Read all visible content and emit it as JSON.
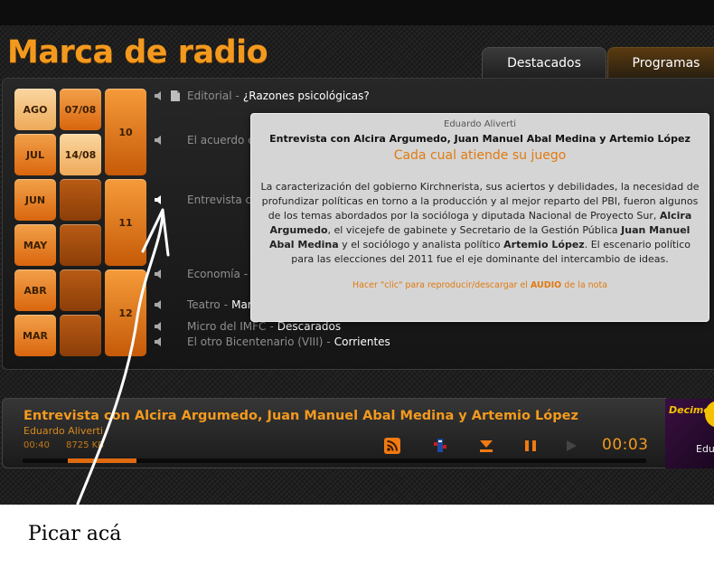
{
  "brand": "Marca de radio",
  "tabs": [
    {
      "label": "Destacados"
    },
    {
      "label": "Programas"
    }
  ],
  "calendar": {
    "months": [
      "AGO",
      "JUL",
      "JUN",
      "MAY",
      "ABR",
      "MAR"
    ],
    "dates": [
      "07/08",
      "14/08"
    ],
    "days": [
      "10",
      "11",
      "12"
    ]
  },
  "programs": [
    {
      "title": "Editorial",
      "item": "¿Razones psicológicas?"
    },
    {
      "title": "El acuerdo e",
      "item": ""
    },
    {
      "title": "Entrevista co",
      "item": ""
    },
    {
      "title": "Economía",
      "item": ""
    },
    {
      "title": "Teatro",
      "item": "Mariano Moreno"
    },
    {
      "title": "Micro del IMFC",
      "item": "Descarados"
    },
    {
      "title": "El otro Bicentenario (VIII)",
      "item": "Corrientes"
    }
  ],
  "tooltip": {
    "author": "Eduardo Aliverti",
    "headline": "Entrevista con Alcira Argumedo, Juan Manuel Abal Medina y Artemio López",
    "title": "Cada cual atiende su juego",
    "body": {
      "p1": "La caracterización del gobierno Kirchnerista, sus aciertos y debilidades, la necesidad de profundizar políticas en torno a la producción y al mejor reparto del PBI, fueron algunos de los temas abordados por la socióloga y diputada Nacional de Proyecto Sur, ",
      "n1": "Alcira Argumedo",
      "p2": ", el vicejefe de gabinete y Secretario de la Gestión Pública ",
      "n2": "Juan Manuel Abal Medina",
      "p3": " y el sociólogo y analista político ",
      "n3": "Artemio López",
      "p4": ". El escenario político para las elecciones del 2011 fue el eje dominante del intercambio de ideas."
    },
    "cta_pre": "Hacer \"clic\" para reproducir/descargar el ",
    "cta_bold": "AUDIO",
    "cta_post": " de la nota"
  },
  "player": {
    "title": "Entrevista con Alcira Argumedo, Juan Manuel Abal Medina y Artemio López",
    "author": "Eduardo Aliverti",
    "position": "00:40",
    "size": "8725 KB",
    "elapsed": "00:03",
    "progress": 0.11,
    "buttons": [
      "rss-icon",
      "podcast-icon",
      "download-icon",
      "pause-icon",
      "play-icon"
    ]
  },
  "ad": {
    "logo": "Decime",
    "text": "Edu"
  },
  "annotation": {
    "caption": "Picar acá"
  },
  "colors": {
    "accent": "#f39a1e",
    "cell": "#e07a1e",
    "tooltip_bg": "#d5d5d5"
  }
}
